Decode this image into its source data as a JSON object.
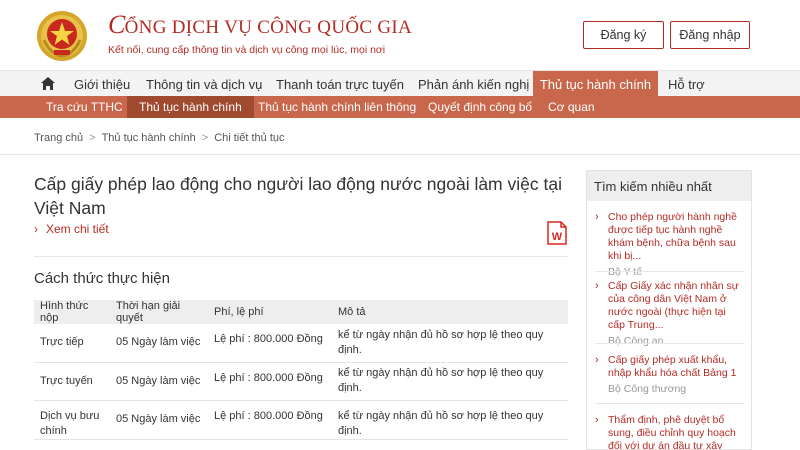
{
  "header": {
    "title_initial": "C",
    "title_rest": "ỔNG DỊCH VỤ CÔNG QUỐC GIA",
    "subtitle": "Kết nối, cung cấp thông tin và dịch vụ công mọi lúc, mọi nơi",
    "register_label": "Đăng ký",
    "login_label": "Đăng nhập",
    "brand_color": "#b42b25"
  },
  "main_nav": {
    "home_icon": "home-icon",
    "items": [
      {
        "label": "Giới thiệu"
      },
      {
        "label": "Thông tin và dịch vụ"
      },
      {
        "label": "Thanh toán trực tuyến"
      },
      {
        "label": "Phản ánh kiến nghị"
      },
      {
        "label": "Thủ tục hành chính",
        "active": true
      },
      {
        "label": "Hỗ trợ"
      }
    ],
    "active_color": "#c8674b"
  },
  "sub_nav": {
    "items": [
      {
        "label": "Tra cứu TTHC"
      },
      {
        "label": "Thủ tục hành chính",
        "active": true
      },
      {
        "label": "Thủ tục hành chính liên thông"
      },
      {
        "label": "Quyết định công bố"
      },
      {
        "label": "Cơ quan"
      }
    ]
  },
  "breadcrumb": [
    "Trang chủ",
    "Thủ tục hành chính",
    "Chi tiết thủ tục"
  ],
  "breadcrumb_sep": ">",
  "procedure": {
    "title": "Cấp giấy phép lao động cho người lao động nước ngoài làm việc tại Việt Nam",
    "detail_link": "Xem chi tiết",
    "detail_arrow": "›",
    "word_icon": "word-document-icon"
  },
  "methods": {
    "section_title": "Cách thức thực hiện",
    "columns": [
      "Hình thức nộp",
      "Thời hạn giải quyết",
      "Phí, lệ phí",
      "Mô tả"
    ],
    "rows": [
      {
        "form": "Trực tiếp",
        "deadline": "05 Ngày làm việc",
        "fee": "Lệ phí : 800.000 Đồng",
        "desc": "kể từ ngày nhận đủ hồ sơ hợp lệ theo quy định."
      },
      {
        "form": "Trực tuyến",
        "deadline": "05 Ngày làm việc",
        "fee": "Lệ phí : 800.000 Đồng",
        "desc": "kể từ ngày nhận đủ hồ sơ hợp lệ theo quy định."
      },
      {
        "form": "Dịch vụ bưu chính",
        "deadline": "05 Ngày làm việc",
        "fee": "Lệ phí : 800.000 Đồng",
        "desc": "kể từ ngày nhận đủ hồ sơ hợp lệ theo quy định."
      }
    ]
  },
  "sidebar": {
    "title": "Tìm kiếm nhiều nhất",
    "arrow": "›",
    "items": [
      {
        "text": "Cho phép người hành nghề được tiếp tục hành nghề khám bệnh, chữa bệnh sau khi bị...",
        "org": "Bộ Y tế"
      },
      {
        "text": "Cấp Giấy xác nhận nhân sự của công dân Việt Nam ở nước ngoài (thực hiện tại cấp Trung...",
        "org": "Bộ Công an"
      },
      {
        "text": "Cấp giấy phép xuất khẩu, nhập khẩu hóa chất Bảng 1",
        "org": "Bộ Công thương"
      },
      {
        "text": "Thẩm định, phê duyệt bổ sung, điều chỉnh quy hoạch đối với dự án đầu tư xây dựng công",
        "org": ""
      }
    ]
  }
}
